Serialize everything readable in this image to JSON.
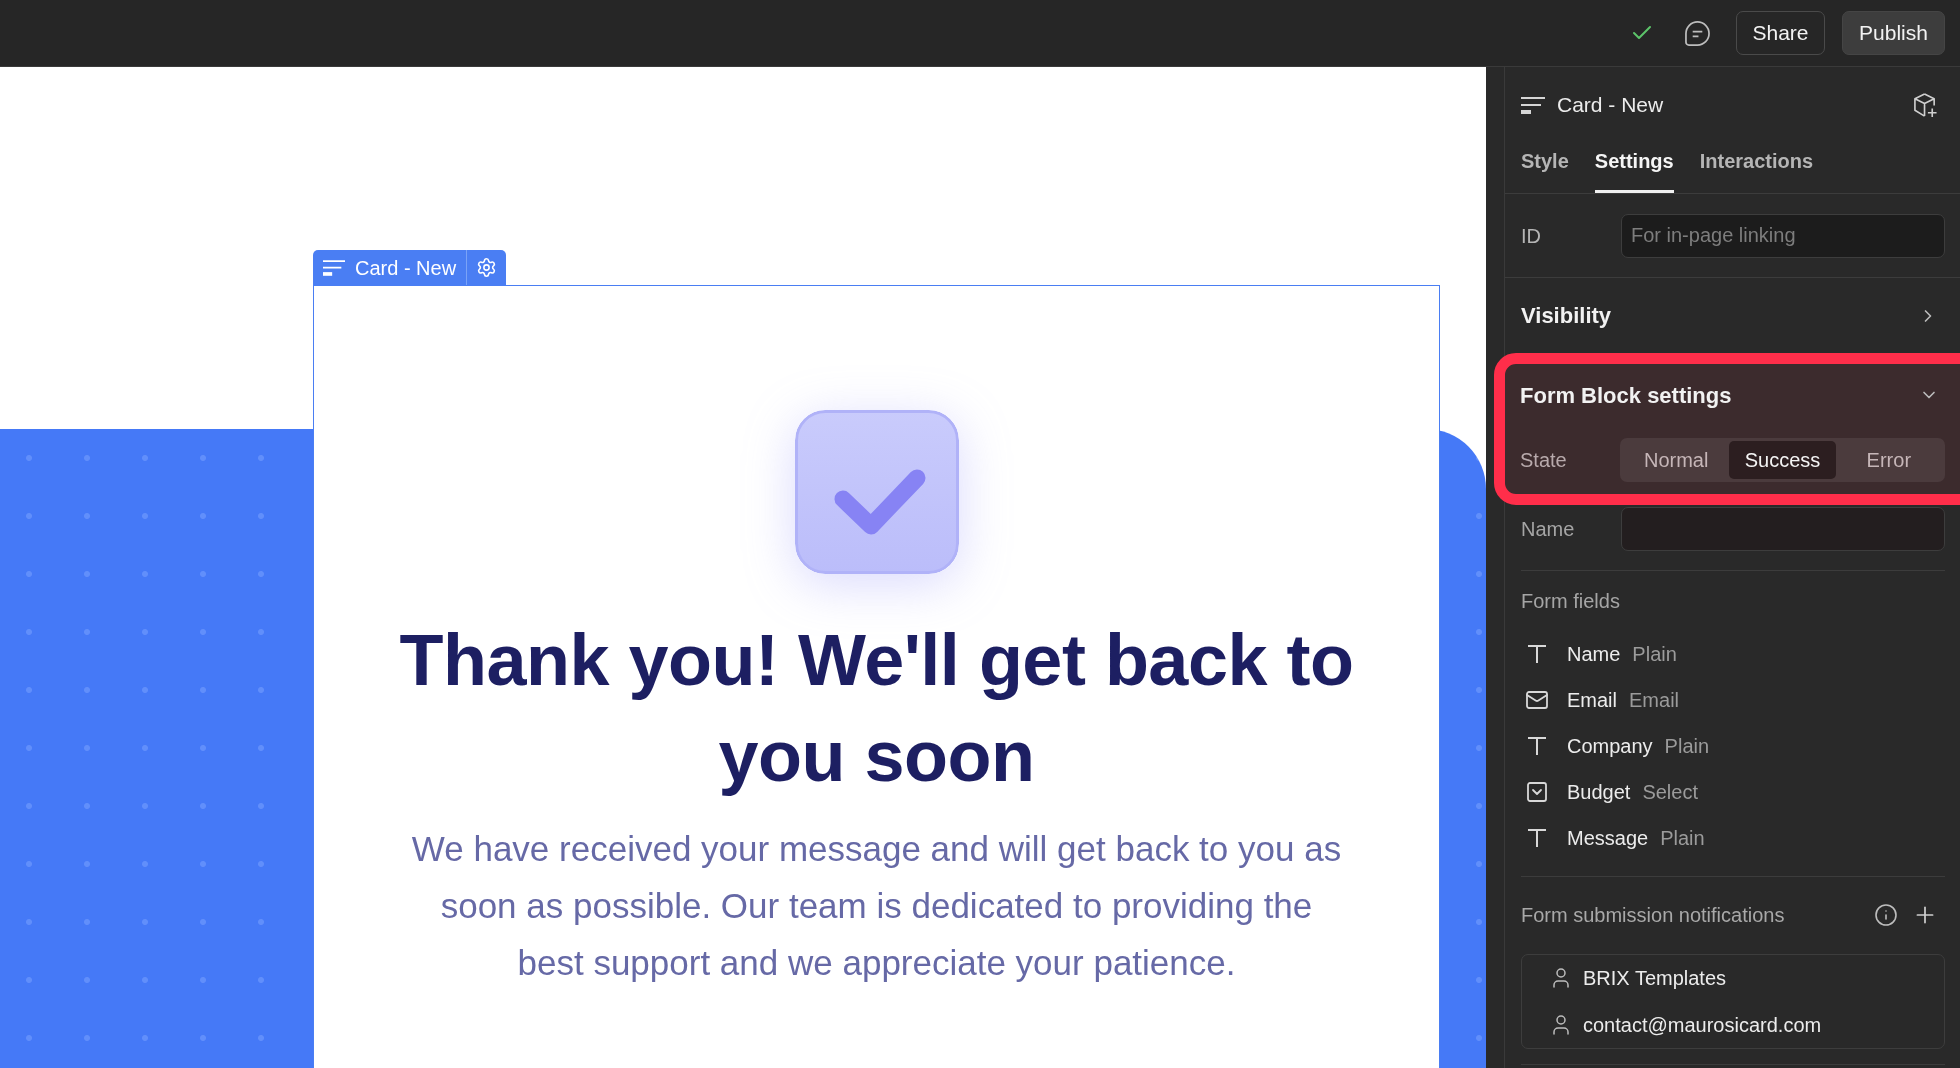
{
  "toolbar": {
    "buttons": [
      {
        "label": "Share",
        "kind": "outline"
      },
      {
        "label": "Publish",
        "kind": "filled"
      }
    ]
  },
  "canvas": {
    "selection_label": "Card - New",
    "heading": "Thank you! We'll get back to you soon",
    "message": "We have received your message and will get back to you as soon as possible. Our team is dedicated to providing the best support and we appreciate your patience."
  },
  "panel": {
    "title": "Card - New",
    "tabs": [
      {
        "label": "Style",
        "selected": false
      },
      {
        "label": "Settings",
        "selected": true
      },
      {
        "label": "Interactions",
        "selected": false
      }
    ],
    "id_field": {
      "label": "ID",
      "placeholder": "For in-page linking"
    },
    "visibility": {
      "title": "Visibility",
      "expanded": false
    },
    "form_block": {
      "title": "Form Block settings",
      "expanded": true,
      "highlighted": true,
      "state": {
        "label": "State",
        "options": [
          {
            "label": "Normal",
            "selected": false
          },
          {
            "label": "Success",
            "selected": true
          },
          {
            "label": "Error",
            "selected": false
          }
        ]
      },
      "name_field": {
        "label": "Name"
      },
      "fields_heading": "Form fields",
      "fields": [
        {
          "kind": "text",
          "name": "Name",
          "type": "Plain"
        },
        {
          "kind": "email",
          "name": "Email",
          "type": "Email"
        },
        {
          "kind": "text",
          "name": "Company",
          "type": "Plain"
        },
        {
          "kind": "select",
          "name": "Budget",
          "type": "Select"
        },
        {
          "kind": "text",
          "name": "Message",
          "type": "Plain"
        }
      ],
      "notifications": {
        "label": "Form submission notifications",
        "recipients": [
          "BRIX Templates",
          "contact@maurosicard.com"
        ]
      }
    }
  }
}
